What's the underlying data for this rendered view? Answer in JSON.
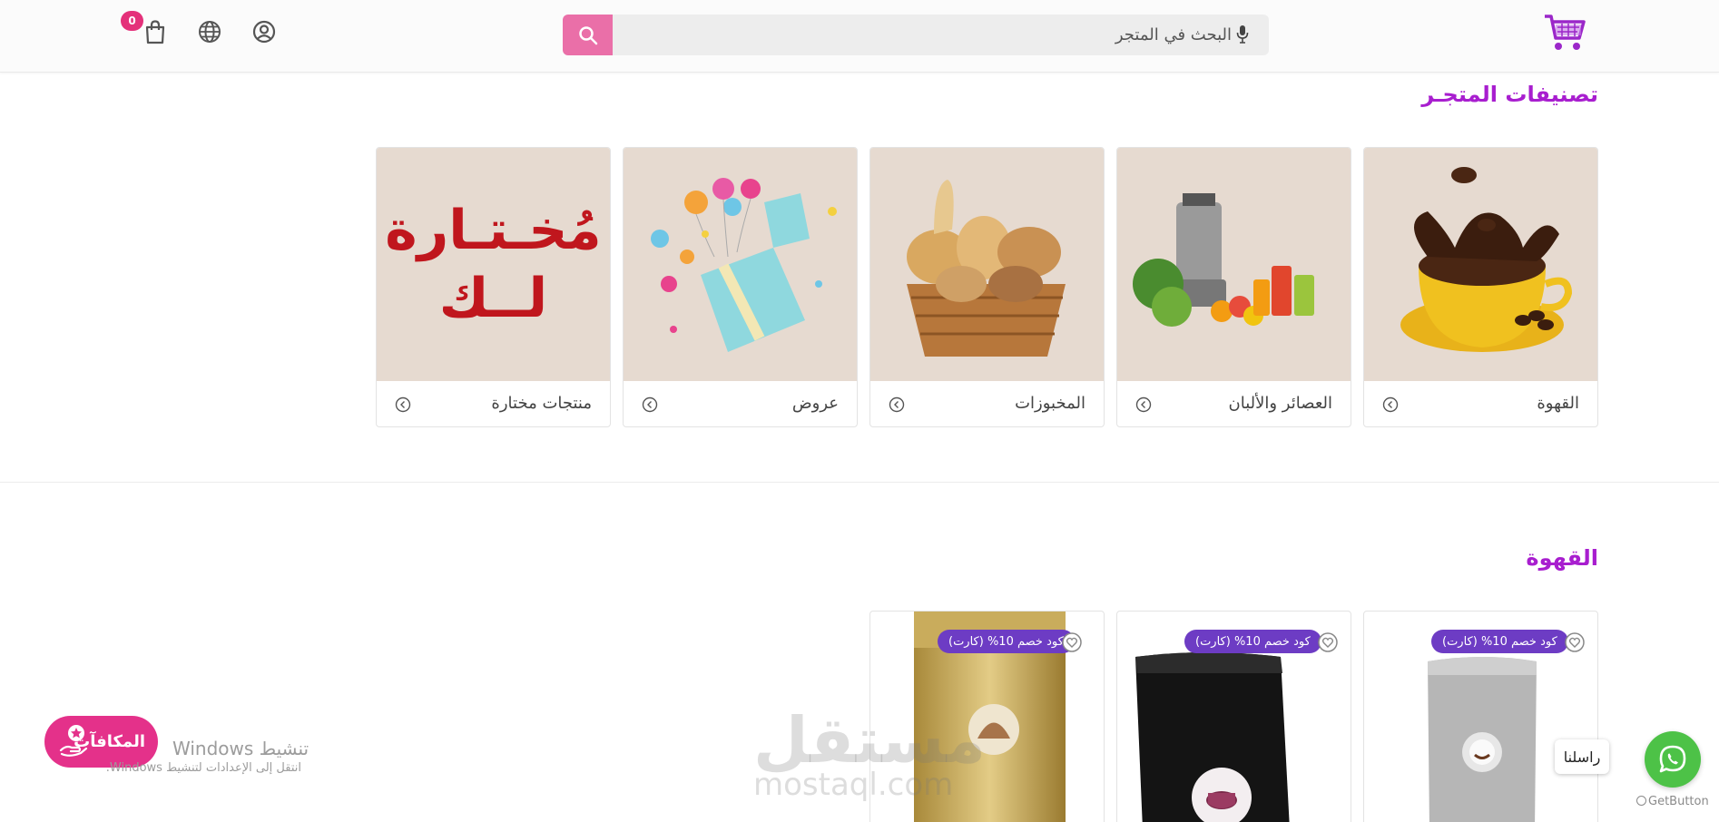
{
  "header": {
    "cart_count": "0",
    "search_placeholder": "البحث في المتجر"
  },
  "categories": {
    "title": "تصنيفات المتجـر",
    "items": [
      {
        "label": "القهوة"
      },
      {
        "label": "العصائر والألبان"
      },
      {
        "label": "المخبوزات"
      },
      {
        "label": "عروض"
      },
      {
        "label": "منتجات مختارة"
      }
    ],
    "selected_card_line1": "مُخـتـارة",
    "selected_card_line2": "لــك"
  },
  "coffee": {
    "title": "القهوة",
    "products": [
      {
        "badge": "كود خصم 10% (كارت)"
      },
      {
        "badge": "كود خصم 10% (كارت)"
      },
      {
        "badge": "كود خصم 10% (كارت)"
      }
    ]
  },
  "floating": {
    "rewards_label": "المكافآت",
    "windows_title": "تنشيط Windows",
    "windows_sub": "انتقل إلى الإعدادات لتنشيط Windows.",
    "whatsapp_tooltip": "راسلنا",
    "getbutton": "GetButton"
  },
  "watermark": {
    "arabic": "مستقل",
    "latin": "mostaql.com"
  },
  "colors": {
    "accent": "#a81ecf",
    "search_button": "#ea6fa8",
    "badge": "#6d3cc4",
    "rewards": "#e4318a",
    "whatsapp": "#4dc247",
    "card_bg": "#e6dad0"
  }
}
